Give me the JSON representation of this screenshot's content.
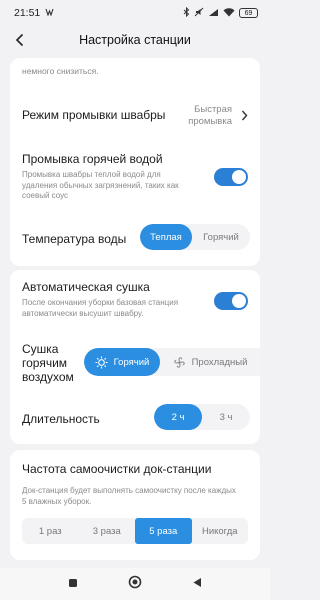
{
  "status": {
    "time": "21:51",
    "battery": "69"
  },
  "header": {
    "title": "Настройка станции"
  },
  "top_card": {
    "cut_text": "немного снизиться.",
    "wash_mode": {
      "title": "Режим промывки швабры",
      "value": "Быстрая промывка"
    },
    "hot_wash": {
      "title": "Промывка горячей водой",
      "description": "Промывка швабры теплой водой для удаления обычных загрязнений, таких как соевый соус",
      "enabled": true
    },
    "water_temp": {
      "title": "Температура воды",
      "options": [
        "Теплая",
        "Горячий"
      ],
      "selected": "Теплая"
    }
  },
  "dry_card": {
    "auto_dry": {
      "title": "Автоматическая сушка",
      "description": "После окончания уборки базовая станция автоматически высушит швабру.",
      "enabled": true
    },
    "hot_air": {
      "title_lines": [
        "Сушка",
        "горячим",
        "воздухом"
      ],
      "options": [
        "Горячий",
        "Прохладный"
      ],
      "selected": "Горячий"
    },
    "duration": {
      "title": "Длительность",
      "options": [
        "2 ч",
        "3 ч"
      ],
      "selected": "2 ч"
    }
  },
  "freq_card": {
    "title": "Частота самоочистки док-станции",
    "description": "Док-станция будет выполнять самоочистку после каждых 5 влажных уборок.",
    "options": [
      "1 раз",
      "3 раза",
      "5 раза",
      "Никогда"
    ],
    "selected": "5 раза"
  },
  "colors": {
    "accent": "#2b8ee0",
    "toggle_on": "#2b7fd4",
    "background": "#f2f2f4"
  }
}
